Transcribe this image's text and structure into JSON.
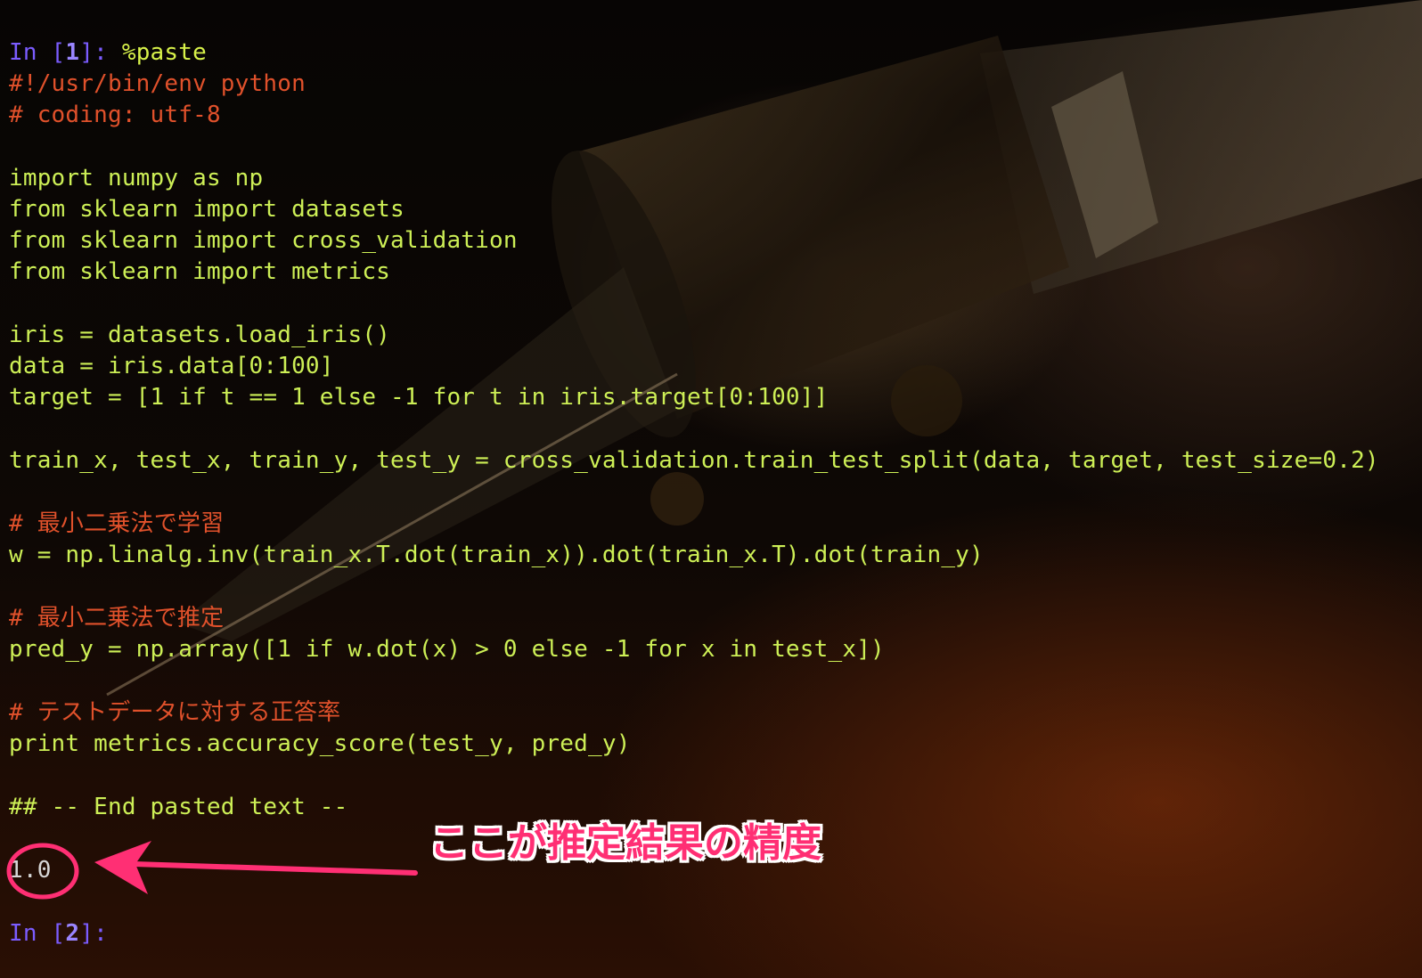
{
  "terminal": {
    "prompt1": {
      "label": "In [",
      "number": "1",
      "close": "]: ",
      "command": "%paste"
    },
    "lines": {
      "shebang": "#!/usr/bin/env python",
      "coding": "# coding: utf-8",
      "import_numpy": "import numpy as np",
      "import_datasets": "from sklearn import datasets",
      "import_cv": "from sklearn import cross_validation",
      "import_metrics": "from sklearn import metrics",
      "iris": "iris = datasets.load_iris()",
      "data": "data = iris.data[0:100]",
      "target": "target = [1 if t == 1 else -1 for t in iris.target[0:100]]",
      "split": "train_x, test_x, train_y, test_y = cross_validation.train_test_split(data, target, test_size=0.2)",
      "comment_fit": "# 最小二乗法で学習",
      "w": "w = np.linalg.inv(train_x.T.dot(train_x)).dot(train_x.T).dot(train_y)",
      "comment_predict": "# 最小二乗法で推定",
      "pred": "pred_y = np.array([1 if w.dot(x) > 0 else -1 for x in test_x])",
      "comment_acc": "# テストデータに対する正答率",
      "print": "print metrics.accuracy_score(test_y, pred_y)",
      "end_paste": "## -- End pasted text --"
    },
    "output_value": "1.0",
    "prompt2": {
      "label": "In [",
      "number": "2",
      "close": "]: "
    }
  },
  "annotation": {
    "text": "ここが推定結果の精度",
    "color": "#ff2f74"
  }
}
